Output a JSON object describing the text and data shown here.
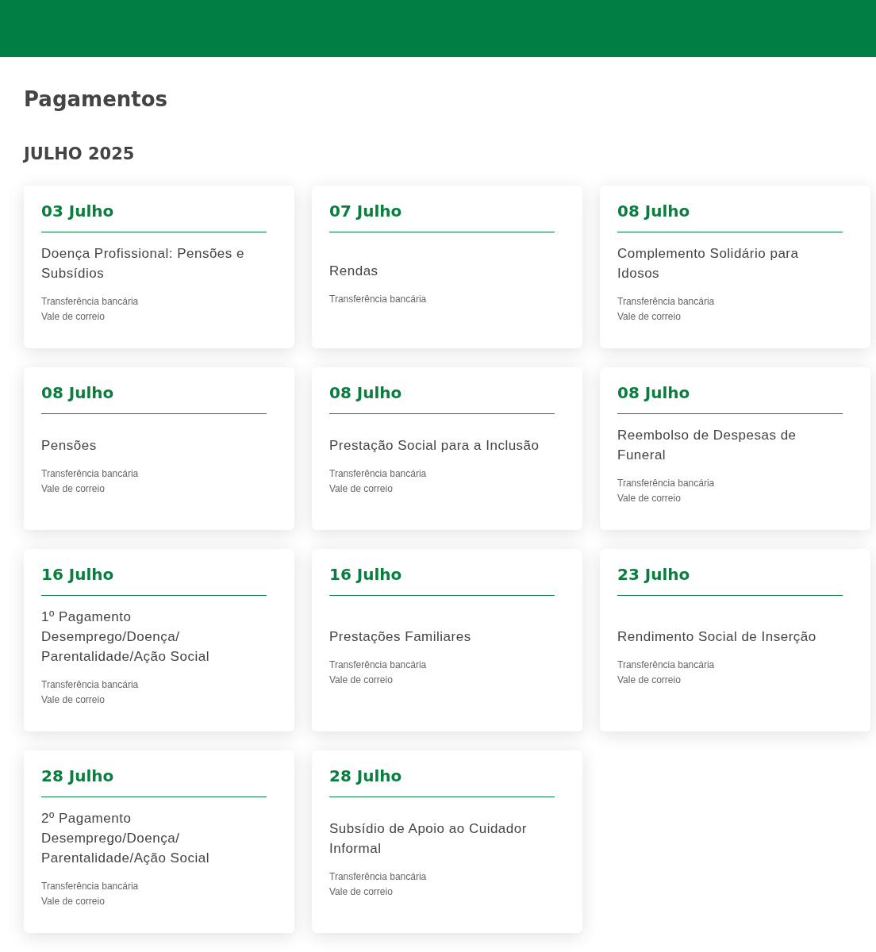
{
  "page_title": "Pagamentos",
  "month": "JULHO 2025",
  "payments": [
    {
      "date": "03 Julho",
      "title": "Doença Profissional: Pensões e Subsídios",
      "methods": [
        "Transferência bancária",
        "Vale de correio"
      ]
    },
    {
      "date": "07 Julho",
      "title": "Rendas",
      "methods": [
        "Transferência bancária"
      ]
    },
    {
      "date": "08 Julho",
      "title": "Complemento Solidário para Idosos",
      "methods": [
        "Transferência bancária",
        "Vale de correio"
      ]
    },
    {
      "date": "08 Julho",
      "title": "Pensões",
      "methods": [
        "Transferência bancária",
        "Vale de correio"
      ]
    },
    {
      "date": "08 Julho",
      "title": "Prestação Social para a Inclusão",
      "methods": [
        "Transferência bancária",
        "Vale de correio"
      ]
    },
    {
      "date": "08 Julho",
      "title": "Reembolso de Despesas de Funeral",
      "methods": [
        "Transferência bancária",
        "Vale de correio"
      ]
    },
    {
      "date": "16 Julho",
      "title": "1º Pagamento Desemprego/Doença/ Parentalidade/Ação Social",
      "methods": [
        "Transferência bancária",
        "Vale de correio"
      ]
    },
    {
      "date": "16 Julho",
      "title": "Prestações Familiares",
      "methods": [
        "Transferência bancária",
        "Vale de correio"
      ]
    },
    {
      "date": "23 Julho",
      "title": "Rendimento Social de Inserção",
      "methods": [
        "Transferência bancária",
        "Vale de correio"
      ]
    },
    {
      "date": "28 Julho",
      "title": "2º Pagamento Desemprego/Doença/ Parentalidade/Ação Social",
      "methods": [
        "Transferência bancária",
        "Vale de correio"
      ]
    },
    {
      "date": "28 Julho",
      "title": "Subsídio de Apoio ao Cuidador Informal",
      "methods": [
        "Transferência bancária",
        "Vale de correio"
      ]
    }
  ]
}
